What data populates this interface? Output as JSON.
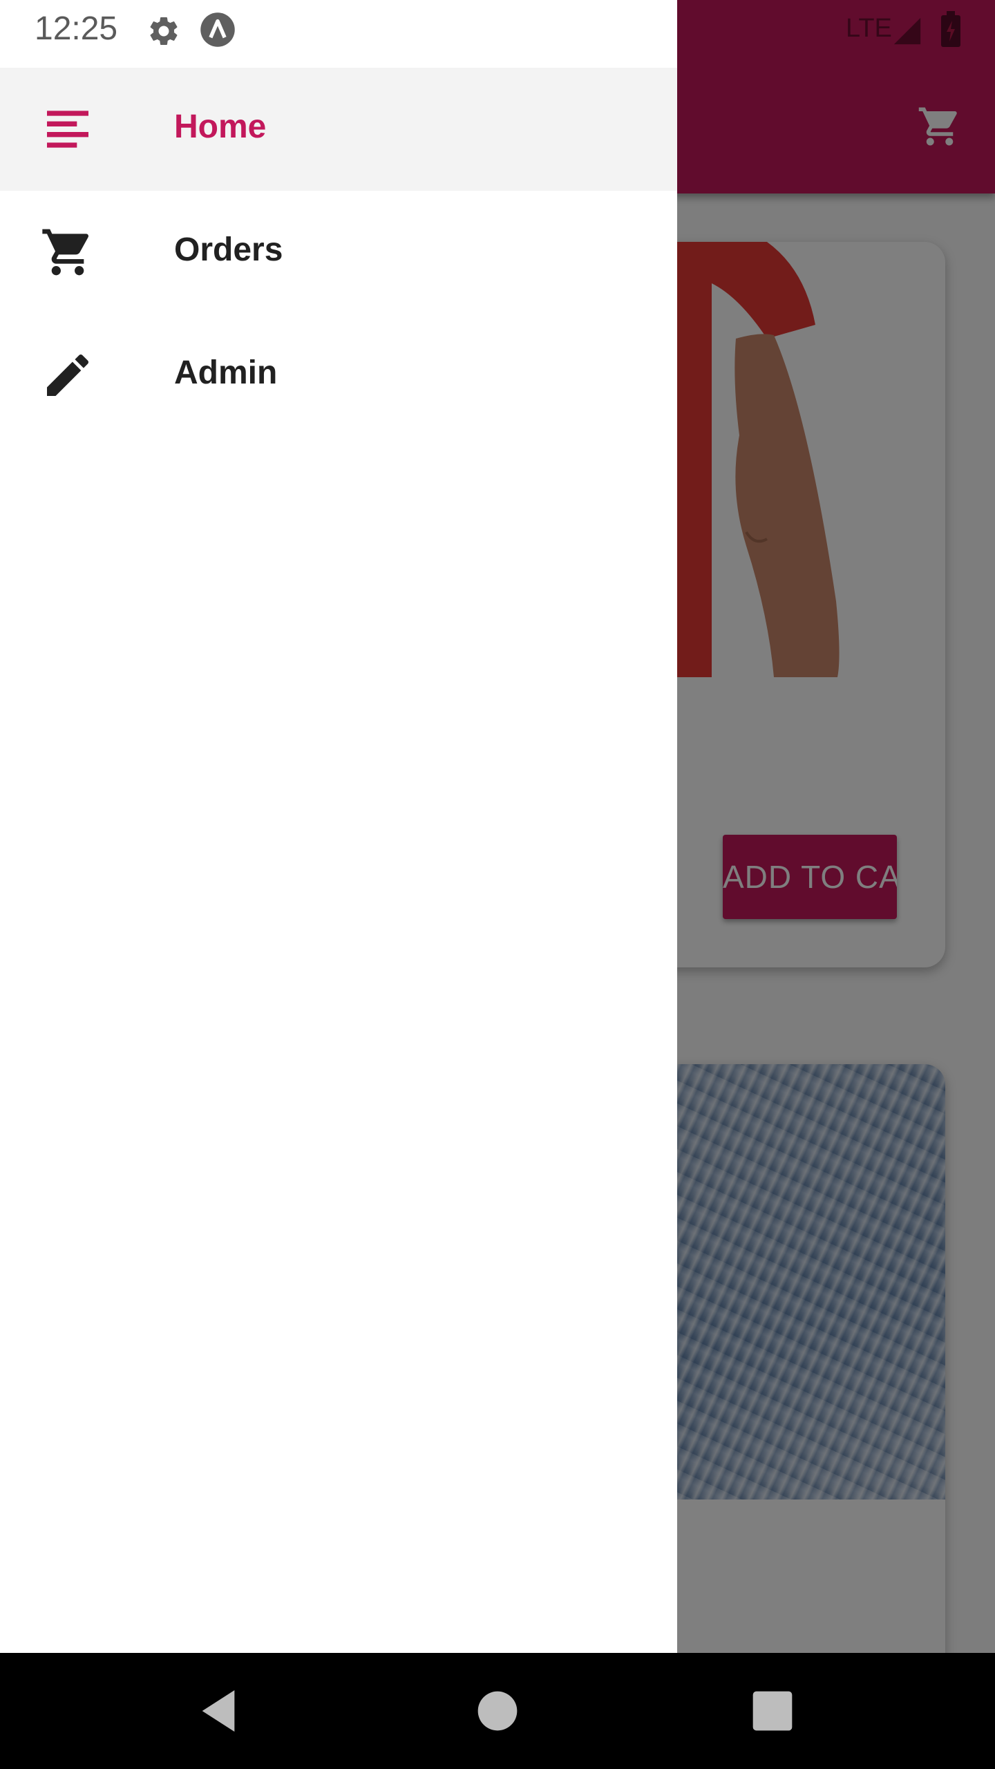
{
  "status_bar": {
    "time": "12:25",
    "network": "LTE",
    "icons": [
      "gear-icon",
      "arch-icon",
      "signal-icon",
      "battery-icon"
    ]
  },
  "app": {
    "toolbar_icon": "cart-icon",
    "primary_color": "#c2185b",
    "product_button_label": "ADD TO CART",
    "product_images": [
      "red-shirt-image",
      "blue-sweater-image"
    ]
  },
  "drawer": {
    "items": [
      {
        "label": "Home",
        "icon": "menu-lines-icon",
        "selected": true
      },
      {
        "label": "Orders",
        "icon": "cart-icon",
        "selected": false
      },
      {
        "label": "Admin",
        "icon": "pencil-icon",
        "selected": false
      }
    ],
    "selected_color": "#c2185b"
  },
  "system_nav": {
    "buttons": [
      "back-icon",
      "home-icon",
      "recents-icon"
    ]
  }
}
